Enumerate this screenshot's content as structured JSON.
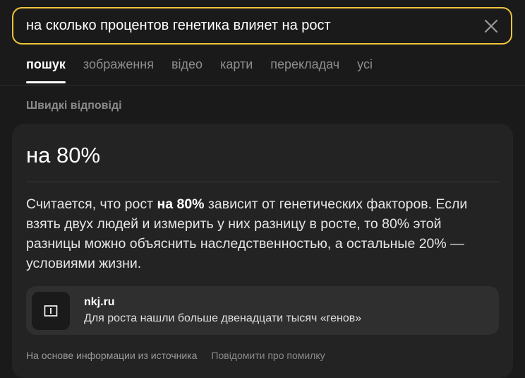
{
  "search": {
    "query": "на сколько процентов генетика влияет на рост",
    "clear_icon": "close-icon"
  },
  "tabs": [
    {
      "label": "пошук",
      "active": true
    },
    {
      "label": "зображення",
      "active": false
    },
    {
      "label": "відео",
      "active": false
    },
    {
      "label": "карти",
      "active": false
    },
    {
      "label": "перекладач",
      "active": false
    },
    {
      "label": "усі",
      "active": false
    }
  ],
  "quick_answers": {
    "section_title": "Швидкі відповіді",
    "answer": "на 80%",
    "text_before": "Считается, что рост ",
    "text_bold": "на 80%",
    "text_after": " зависит от генетических факторов. Если взять двух людей и измерить у них разницу в росте, то 80% этой разницы можно объяснить наследственностью, а остальные 20% — условиями жизни.",
    "source": {
      "domain": "nkj.ru",
      "title": "Для роста нашли больше двенадцати тысяч «генов»",
      "icon": "site-logo-icon"
    },
    "footer_note": "На основе информации из источника",
    "report_link": "Повідомити про помилку"
  },
  "colors": {
    "background": "#1a1a1a",
    "card": "#232323",
    "accent_border": "#f0c43a"
  }
}
